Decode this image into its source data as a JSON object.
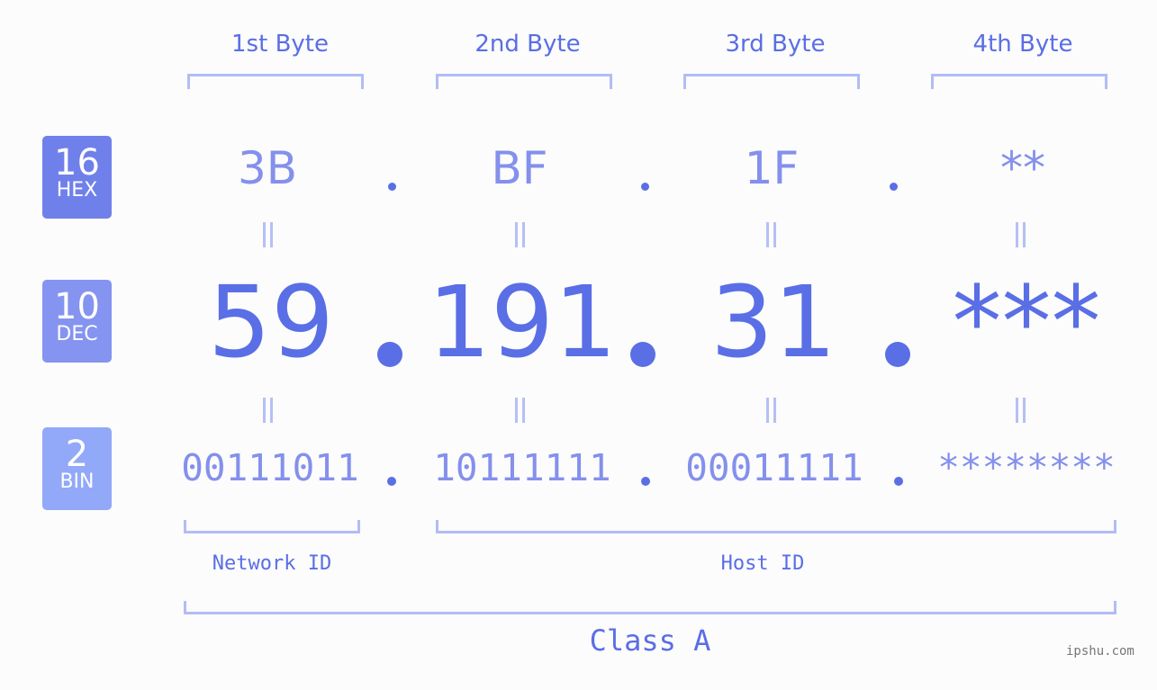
{
  "byte_headers": [
    "1st Byte",
    "2nd Byte",
    "3rd Byte",
    "4th Byte"
  ],
  "badges": [
    {
      "number": "16",
      "label": "HEX",
      "color": "#7080ea"
    },
    {
      "number": "10",
      "label": "DEC",
      "color": "#8494f0"
    },
    {
      "number": "2",
      "label": "BIN",
      "color": "#92a8f8"
    }
  ],
  "hex": [
    "3B",
    "BF",
    "1F",
    "**"
  ],
  "dec": [
    "59",
    "191",
    "31",
    "***"
  ],
  "bin": [
    "00111011",
    "10111111",
    "00011111",
    "********"
  ],
  "network_label": "Network ID",
  "host_label": "Host ID",
  "class_label": "Class A",
  "watermark": "ipshu.com",
  "colors": {
    "primary": "#5a6ee6",
    "light": "#8490ec",
    "bracket": "#b3bcf5"
  }
}
